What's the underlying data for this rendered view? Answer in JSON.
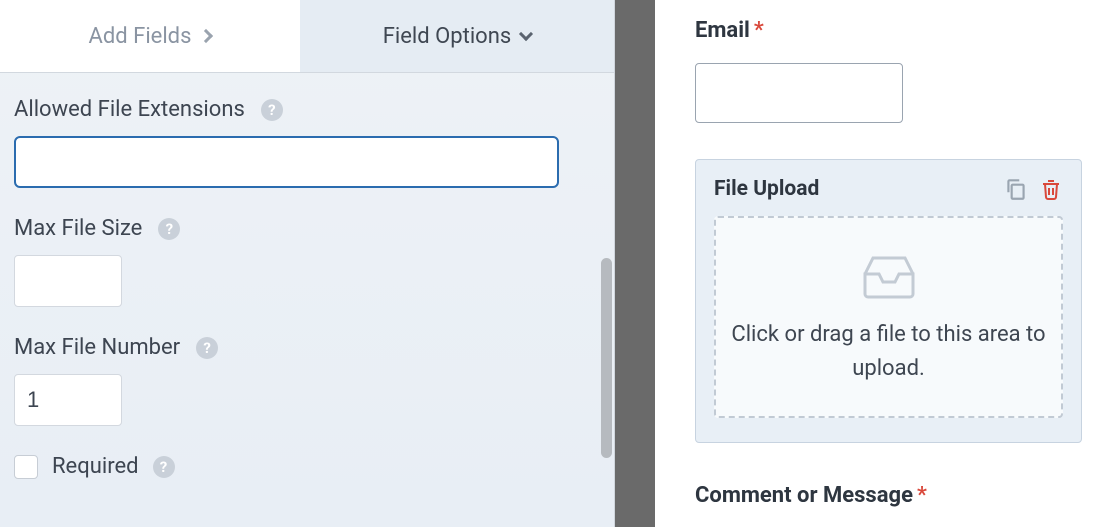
{
  "tabs": {
    "add_fields": "Add Fields",
    "field_options": "Field Options"
  },
  "options": {
    "allowed_ext_label": "Allowed File Extensions",
    "allowed_ext_value": "",
    "max_size_label": "Max File Size",
    "max_size_value": "",
    "max_num_label": "Max File Number",
    "max_num_value": "1",
    "required_label": "Required"
  },
  "form": {
    "email_label": "Email",
    "upload_label": "File Upload",
    "dropzone_text": "Click or drag a file to this area to upload.",
    "comment_label": "Comment or Message"
  },
  "glyphs": {
    "required": "*",
    "help": "?"
  }
}
